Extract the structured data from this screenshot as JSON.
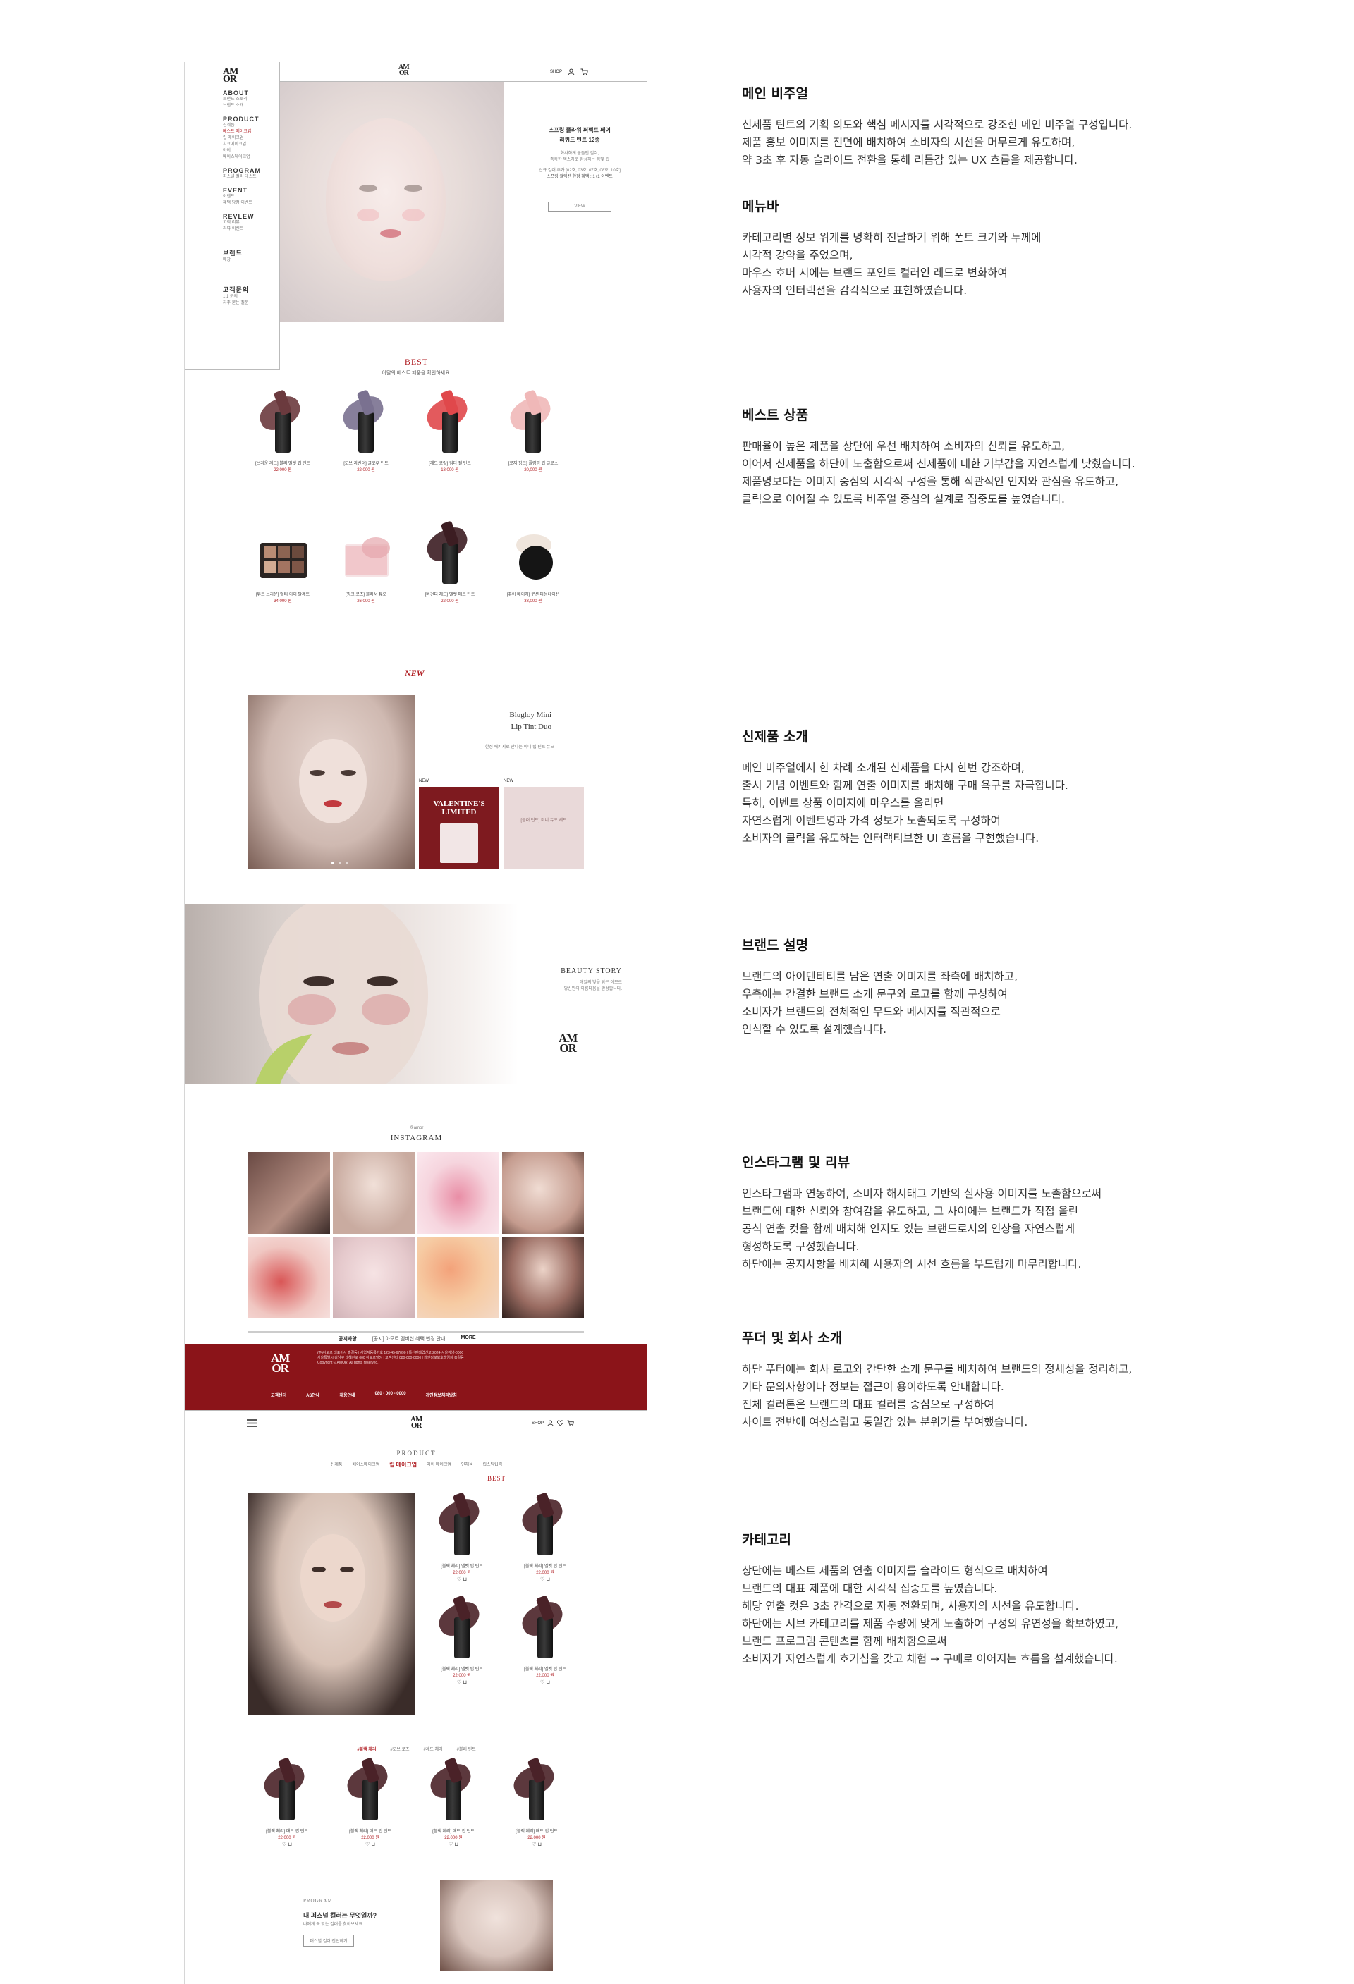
{
  "mockup": {
    "logo": "AM\nOR",
    "nav": {
      "shop_label": "SHOP",
      "user_icon": "user-icon",
      "cart_icon": "cart-icon"
    },
    "side_menu": [
      {
        "label": "ABOUT",
        "subs": [
          "브랜드 스토리",
          "브랜드 소개"
        ]
      },
      {
        "label": "PRODUCT",
        "subs": [
          "신제품",
          "베스트 메이크업",
          "립 메이크업",
          "치크메이크업",
          "아이",
          "베이스메이크업"
        ]
      },
      {
        "label": "PROGRAM",
        "subs": [
          "퍼스널 컬러 테스트"
        ]
      },
      {
        "label": "EVENT",
        "subs": [
          "이벤트",
          "혜택 당첨 이벤트"
        ]
      },
      {
        "label": "REVLEW",
        "subs": [
          "고객 리뷰",
          "리뷰 이벤트"
        ]
      },
      {
        "label": "브랜드",
        "subs": [
          "매장"
        ]
      },
      {
        "label": "고객문의",
        "subs": [
          "1:1 문의",
          "자주 묻는 질문"
        ]
      }
    ],
    "hero": {
      "title": "스프링 플라워 퍼펙트 페어\n리퀴드 틴트 12종",
      "desc": "화사하게 물들인 컬러,\n촉촉한 텍스처로 완성하는 봄빛 립",
      "note": "신규 컬러 추가 [02호, 03호, 07호, 08호, 10호]",
      "note2": "스프링 컬렉션 한정 혜택 : 1+1 이벤트",
      "button": "VIEW"
    },
    "best": {
      "title": "BEST",
      "subtitle": "이달의 베스트 제품을 확인하세요.",
      "products": [
        {
          "name": "[브라운 레드] 블러 벨벳 립 틴트",
          "price": "22,000 원"
        },
        {
          "name": "[모브 라벤더] 글로우 틴트",
          "price": "22,000 원"
        },
        {
          "name": "[레드 코랄] 워터 젤 틴트",
          "price": "18,000 원"
        },
        {
          "name": "[로지 핑크] 플럼핑 립 글로스",
          "price": "20,000 원"
        },
        {
          "name": "[뮤트 브라운] 멀티 아이 팔레트",
          "price": "34,000 원"
        },
        {
          "name": "[핑크 로즈] 블러셔 듀오",
          "price": "26,000 원"
        },
        {
          "name": "[버건디 레드] 벨벳 매트 틴트",
          "price": "22,000 원"
        },
        {
          "name": "[퓨어 베이지] 쿠션 파운데이션",
          "price": "38,000 원"
        }
      ]
    },
    "new": {
      "title": "NEW",
      "product_title": "Blugloy Mini\nLip Tint Duo",
      "product_desc": "한정 패키지로 만나는 미니 립 틴트 듀오",
      "tag1": "NEW",
      "tag2": "NEW",
      "event1": "VALENTINE'S\nLIMITED",
      "event2": "[블러 틴트] 미니 듀오 세트"
    },
    "brand": {
      "title": "BEAUTY STORY",
      "desc": "매일의 빛을 담은 아모르\n당신만의 아름다움을 완성합니다.",
      "logo": "AM\nOR"
    },
    "instagram": {
      "small": "@amor",
      "title": "INSTAGRAM"
    },
    "notice": {
      "label": "공지사항",
      "text": "[공지] 아모르 멤버십 혜택 변경 안내",
      "more": "MORE"
    },
    "footer": {
      "logo": "AM\nOR",
      "info": "(주)아모르 대표이사 홍길동 | 사업자등록번호 123-45-67890 | 통신판매업신고 2024-서울강남-0000\n서울특별시 강남구 테헤란로 000 아모르빌딩 | 고객센터 080-000-0000 | 개인정보보호책임자 홍길동\nCopyright © AMOR. All rights reserved.",
      "links": [
        "고객센터",
        "AS안내",
        "채용안내",
        "080 - 000 - 0000",
        "개인정보처리방침"
      ]
    },
    "category": {
      "menu_icon": "hamburger-icon",
      "title": "PRODUCT",
      "tabs": [
        "신제품",
        "베이스메이크업",
        "립 메이크업",
        "아이 메이크업",
        "인체육",
        "립스틱립릭"
      ],
      "active_tab": "립 메이크업",
      "best_label": "BEST",
      "filters": [
        "#블랙 체리",
        "#모브 로즈",
        "#레드 체리",
        "#블러 틴트"
      ],
      "products": [
        {
          "name": "[블랙 체리] 벨벳 립 틴트",
          "price": "22,000 원"
        },
        {
          "name": "[블랙 체리] 벨벳 립 틴트",
          "price": "22,000 원"
        },
        {
          "name": "[블랙 체리] 벨벳 립 틴트",
          "price": "22,000 원"
        },
        {
          "name": "[블랙 체리] 벨벳 립 틴트",
          "price": "22,000 원"
        }
      ],
      "grid_products": [
        {
          "name": "[블랙 체리] 매트 립 틴트",
          "price": "22,000 원"
        },
        {
          "name": "[블랙 체리] 매트 립 틴트",
          "price": "22,000 원"
        },
        {
          "name": "[블랙 체리] 매트 립 틴트",
          "price": "22,000 원"
        },
        {
          "name": "[블랙 체리] 매트 립 틴트",
          "price": "22,000 원"
        }
      ],
      "program": {
        "label": "PROGRAM",
        "title": "내 퍼스널 컬러는 무엇일까?",
        "desc": "나에게 꼭 맞는 컬러를 찾아보세요.",
        "button": "퍼스널 컬러 진단하기"
      }
    }
  },
  "annotations": [
    {
      "title": "메인 비주얼",
      "body": "신제품 틴트의 기획 의도와 핵심 메시지를 시각적으로 강조한 메인 비주얼 구성입니다.\n제품 홍보 이미지를 전면에 배치하여 소비자의 시선을 머무르게 유도하며,\n약 3초 후 자동 슬라이드 전환을 통해 리듬감 있는 UX 흐름을 제공합니다."
    },
    {
      "title": "메뉴바",
      "body": "카테고리별 정보 위계를 명확히 전달하기 위해  폰트 크기와 두께에\n시각적 강약을 주었으며,\n마우스 호버 시에는 브랜드 포인트 컬러인 레드로 변화하여\n사용자의 인터랙션을 감각적으로 표현하였습니다."
    },
    {
      "title": "베스트 상품",
      "body": "판매율이 높은 제품을 상단에 우선 배치하여 소비자의 신뢰를 유도하고,\n이어서 신제품을 하단에 노출함으로써 신제품에 대한 거부감을 자연스럽게 낮췄습니다.\n제품명보다는 이미지 중심의 시각적 구성을 통해 직관적인 인지와 관심을 유도하고,\n클릭으로 이어질 수 있도록 비주얼 중심의 설계로 집중도를 높였습니다."
    },
    {
      "title": "신제품 소개",
      "body": "메인 비주얼에서 한 차례 소개된 신제품을 다시 한번 강조하며,\n출시 기념 이벤트와 함께 연출 이미지를 배치해 구매 욕구를 자극합니다.\n특히, 이벤트 상품 이미지에 마우스를 올리면\n자연스럽게 이벤트명과 가격 정보가 노출되도록 구성하여\n소비자의 클릭을 유도하는 인터랙티브한 UI 흐름을 구현했습니다."
    },
    {
      "title": "브랜드 설명",
      "body": "브랜드의 아이덴티티를 담은 연출 이미지를 좌측에 배치하고,\n우측에는 간결한 브랜드 소개 문구와 로고를 함께 구성하여\n소비자가 브랜드의 전체적인 무드와 메시지를 직관적으로\n인식할 수 있도록 설계했습니다."
    },
    {
      "title": "인스타그램 및 리뷰",
      "body": "인스타그램과 연동하여, 소비자 해시태그 기반의 실사용 이미지를 노출함으로써\n브랜드에 대한 신뢰와 참여감을 유도하고, 그 사이에는 브랜드가 직접 올린\n공식 연출 컷을 함께 배치해 인지도 있는 브랜드로서의 인상을 자연스럽게\n형성하도록 구성했습니다.\n하단에는 공지사항을 배치해 사용자의 시선 흐름을 부드럽게 마무리합니다."
    },
    {
      "title": "푸더 및 회사 소개",
      "body": "하단 푸터에는 회사 로고와 간단한 소개 문구를 배치하여 브랜드의 정체성을 정리하고,\n기타 문의사항이나 정보는 접근이 용이하도록 안내합니다.\n전체 컬러톤은 브랜드의 대표 컬러를 중심으로 구성하여\n사이트 전반에 여성스럽고 통일감 있는 분위기를 부여했습니다."
    },
    {
      "title": "카테고리",
      "body": "상단에는 베스트 제품의 연출 이미지를 슬라이드 형식으로 배치하여\n브랜드의 대표 제품에 대한 시각적 집중도를 높였습니다.\n해당 연출 컷은 3초 간격으로 자동 전환되며, 사용자의 시선을 유도합니다.\n하단에는 서브 카테고리를 제품 수량에 맞게 노출하여 구성의 유연성을 확보하였고,\n브랜드 프로그램 콘텐츠를 함께 배치함으로써\n소비자가 자연스럽게 호기심을 갖고 체험 → 구매로 이어지는 흐름을 설계했습니다."
    }
  ],
  "colors": {
    "brand_red": "#b01e23",
    "footer_red": "#8b1419"
  }
}
